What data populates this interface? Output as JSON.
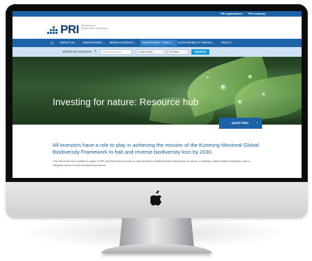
{
  "topbar": {
    "links": [
      "PRI Applications",
      "PRI Academy"
    ],
    "accent": "#1b63a6"
  },
  "logo": {
    "text": "PRI",
    "subtitle": "Principles for Responsible Investment"
  },
  "nav": {
    "home_icon": "home-icon",
    "items": [
      {
        "label": "ABOUT US ⌄"
      },
      {
        "label": "SIGNATORIES ⌄"
      },
      {
        "label": "NEWS & EVENTS ⌄"
      },
      {
        "label": "INVESTMENT TOOLS ⌄",
        "active": true
      },
      {
        "label": "SUSTAINABILITY ISSUES ⌄"
      },
      {
        "label": "POLICY ⌄"
      }
    ]
  },
  "search": {
    "label": "Search our resources",
    "placeholder": "Optional keyword",
    "content_type": "Content Type",
    "all_filters": "All filters",
    "button": "SEARCH"
  },
  "hero": {
    "title": "Investing for nature: Resource hub"
  },
  "quick_links": {
    "label": "Quick links",
    "chevron": "›"
  },
  "intro": {
    "heading": "All investors have a role to play in achieving the mission of the Kunming-Montreal Global Biodiversity Framework to halt and reverse biodiversity loss by 2030.",
    "body": "This Resource hub contains a range of PRI and external resources to help investors understand the importance of nature, to develop nature-related strategies, and to integrate nature in their investment practices."
  },
  "device": {
    "logo_icon": "apple-logo-icon",
    "logo_glyph": ""
  }
}
